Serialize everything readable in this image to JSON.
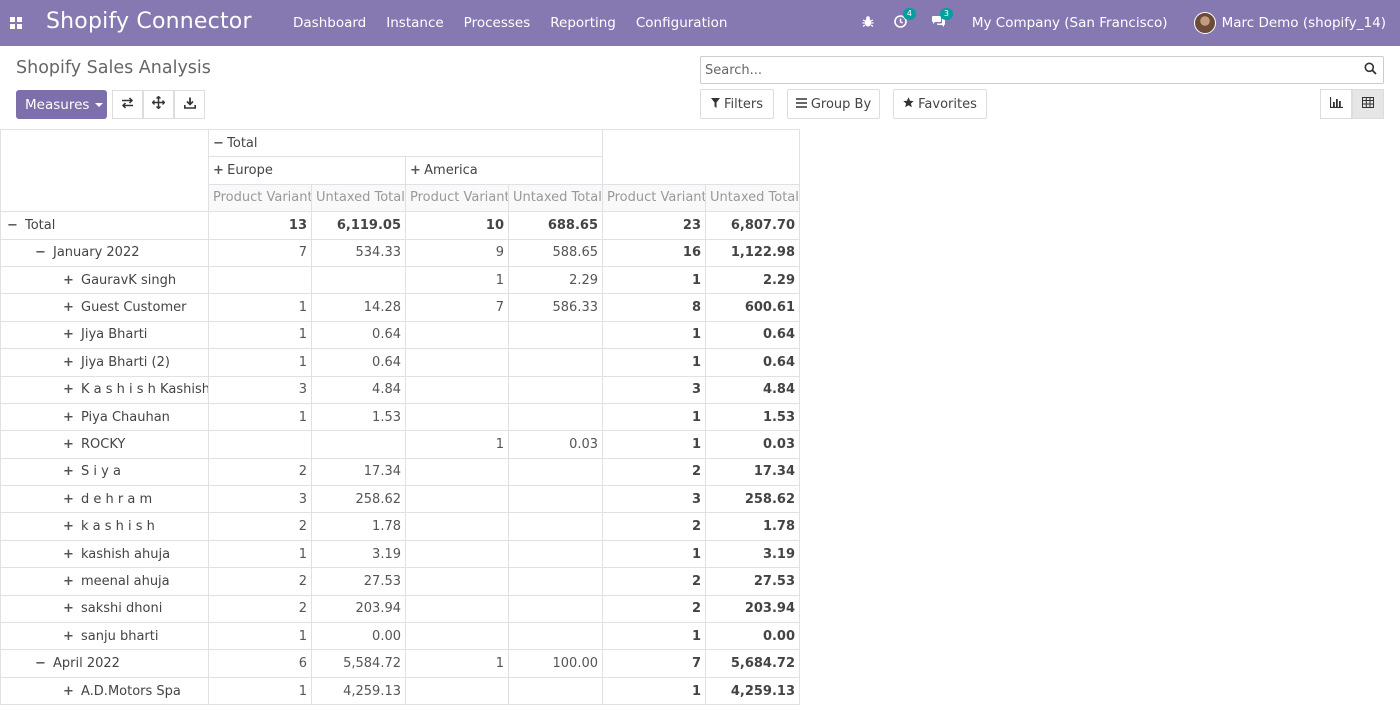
{
  "navbar": {
    "brand": "Shopify Connector",
    "menu": [
      "Dashboard",
      "Instance",
      "Processes",
      "Reporting",
      "Configuration"
    ],
    "activity_count": "4",
    "message_count": "3",
    "company": "My Company (San Francisco)",
    "user": "Marc Demo (shopify_14)",
    "bg_color": "#8679b2"
  },
  "control": {
    "title": "Shopify Sales Analysis",
    "search_placeholder": "Search...",
    "measures_label": "Measures",
    "filters_label": "Filters",
    "groupby_label": "Group By",
    "favorites_label": "Favorites"
  },
  "pivot": {
    "col_total_label": "Total",
    "col_groups": [
      "Europe",
      "America"
    ],
    "measures": [
      "Product Variant",
      "Untaxed Total",
      "Product Variant",
      "Untaxed Total",
      "Product Variant",
      "Untaxed Total"
    ],
    "rows": [
      {
        "level": 0,
        "sign": "−",
        "label": "Total",
        "vals": [
          "13",
          "6,119.05",
          "10",
          "688.65",
          "23",
          "6,807.70"
        ],
        "bold": true
      },
      {
        "level": 1,
        "sign": "−",
        "label": "January 2022",
        "vals": [
          "7",
          "534.33",
          "9",
          "588.65",
          "16",
          "1,122.98"
        ],
        "bold": false
      },
      {
        "level": 2,
        "sign": "+",
        "label": "GauravK singh",
        "vals": [
          "",
          "",
          "1",
          "2.29",
          "1",
          "2.29"
        ],
        "bold": false
      },
      {
        "level": 2,
        "sign": "+",
        "label": "Guest Customer",
        "vals": [
          "1",
          "14.28",
          "7",
          "586.33",
          "8",
          "600.61"
        ],
        "bold": false
      },
      {
        "level": 2,
        "sign": "+",
        "label": "Jiya Bharti",
        "vals": [
          "1",
          "0.64",
          "",
          "",
          "1",
          "0.64"
        ],
        "bold": false
      },
      {
        "level": 2,
        "sign": "+",
        "label": "Jiya Bharti (2)",
        "vals": [
          "1",
          "0.64",
          "",
          "",
          "1",
          "0.64"
        ],
        "bold": false
      },
      {
        "level": 2,
        "sign": "+",
        "label": "K a s h i s h Kashish",
        "vals": [
          "3",
          "4.84",
          "",
          "",
          "3",
          "4.84"
        ],
        "bold": false
      },
      {
        "level": 2,
        "sign": "+",
        "label": "Piya Chauhan",
        "vals": [
          "1",
          "1.53",
          "",
          "",
          "1",
          "1.53"
        ],
        "bold": false
      },
      {
        "level": 2,
        "sign": "+",
        "label": "ROCKY",
        "vals": [
          "",
          "",
          "1",
          "0.03",
          "1",
          "0.03"
        ],
        "bold": false
      },
      {
        "level": 2,
        "sign": "+",
        "label": "S i y a",
        "vals": [
          "2",
          "17.34",
          "",
          "",
          "2",
          "17.34"
        ],
        "bold": false
      },
      {
        "level": 2,
        "sign": "+",
        "label": "d e h r a m",
        "vals": [
          "3",
          "258.62",
          "",
          "",
          "3",
          "258.62"
        ],
        "bold": false
      },
      {
        "level": 2,
        "sign": "+",
        "label": "k a s h i s h",
        "vals": [
          "2",
          "1.78",
          "",
          "",
          "2",
          "1.78"
        ],
        "bold": false
      },
      {
        "level": 2,
        "sign": "+",
        "label": "kashish ahuja",
        "vals": [
          "1",
          "3.19",
          "",
          "",
          "1",
          "3.19"
        ],
        "bold": false
      },
      {
        "level": 2,
        "sign": "+",
        "label": "meenal ahuja",
        "vals": [
          "2",
          "27.53",
          "",
          "",
          "2",
          "27.53"
        ],
        "bold": false
      },
      {
        "level": 2,
        "sign": "+",
        "label": "sakshi dhoni",
        "vals": [
          "2",
          "203.94",
          "",
          "",
          "2",
          "203.94"
        ],
        "bold": false
      },
      {
        "level": 2,
        "sign": "+",
        "label": "sanju bharti",
        "vals": [
          "1",
          "0.00",
          "",
          "",
          "1",
          "0.00"
        ],
        "bold": false
      },
      {
        "level": 1,
        "sign": "−",
        "label": "April 2022",
        "vals": [
          "6",
          "5,584.72",
          "1",
          "100.00",
          "7",
          "5,684.72"
        ],
        "bold": false
      },
      {
        "level": 2,
        "sign": "+",
        "label": "A.D.Motors Spa",
        "vals": [
          "1",
          "4,259.13",
          "",
          "",
          "1",
          "4,259.13"
        ],
        "bold": false
      }
    ]
  }
}
